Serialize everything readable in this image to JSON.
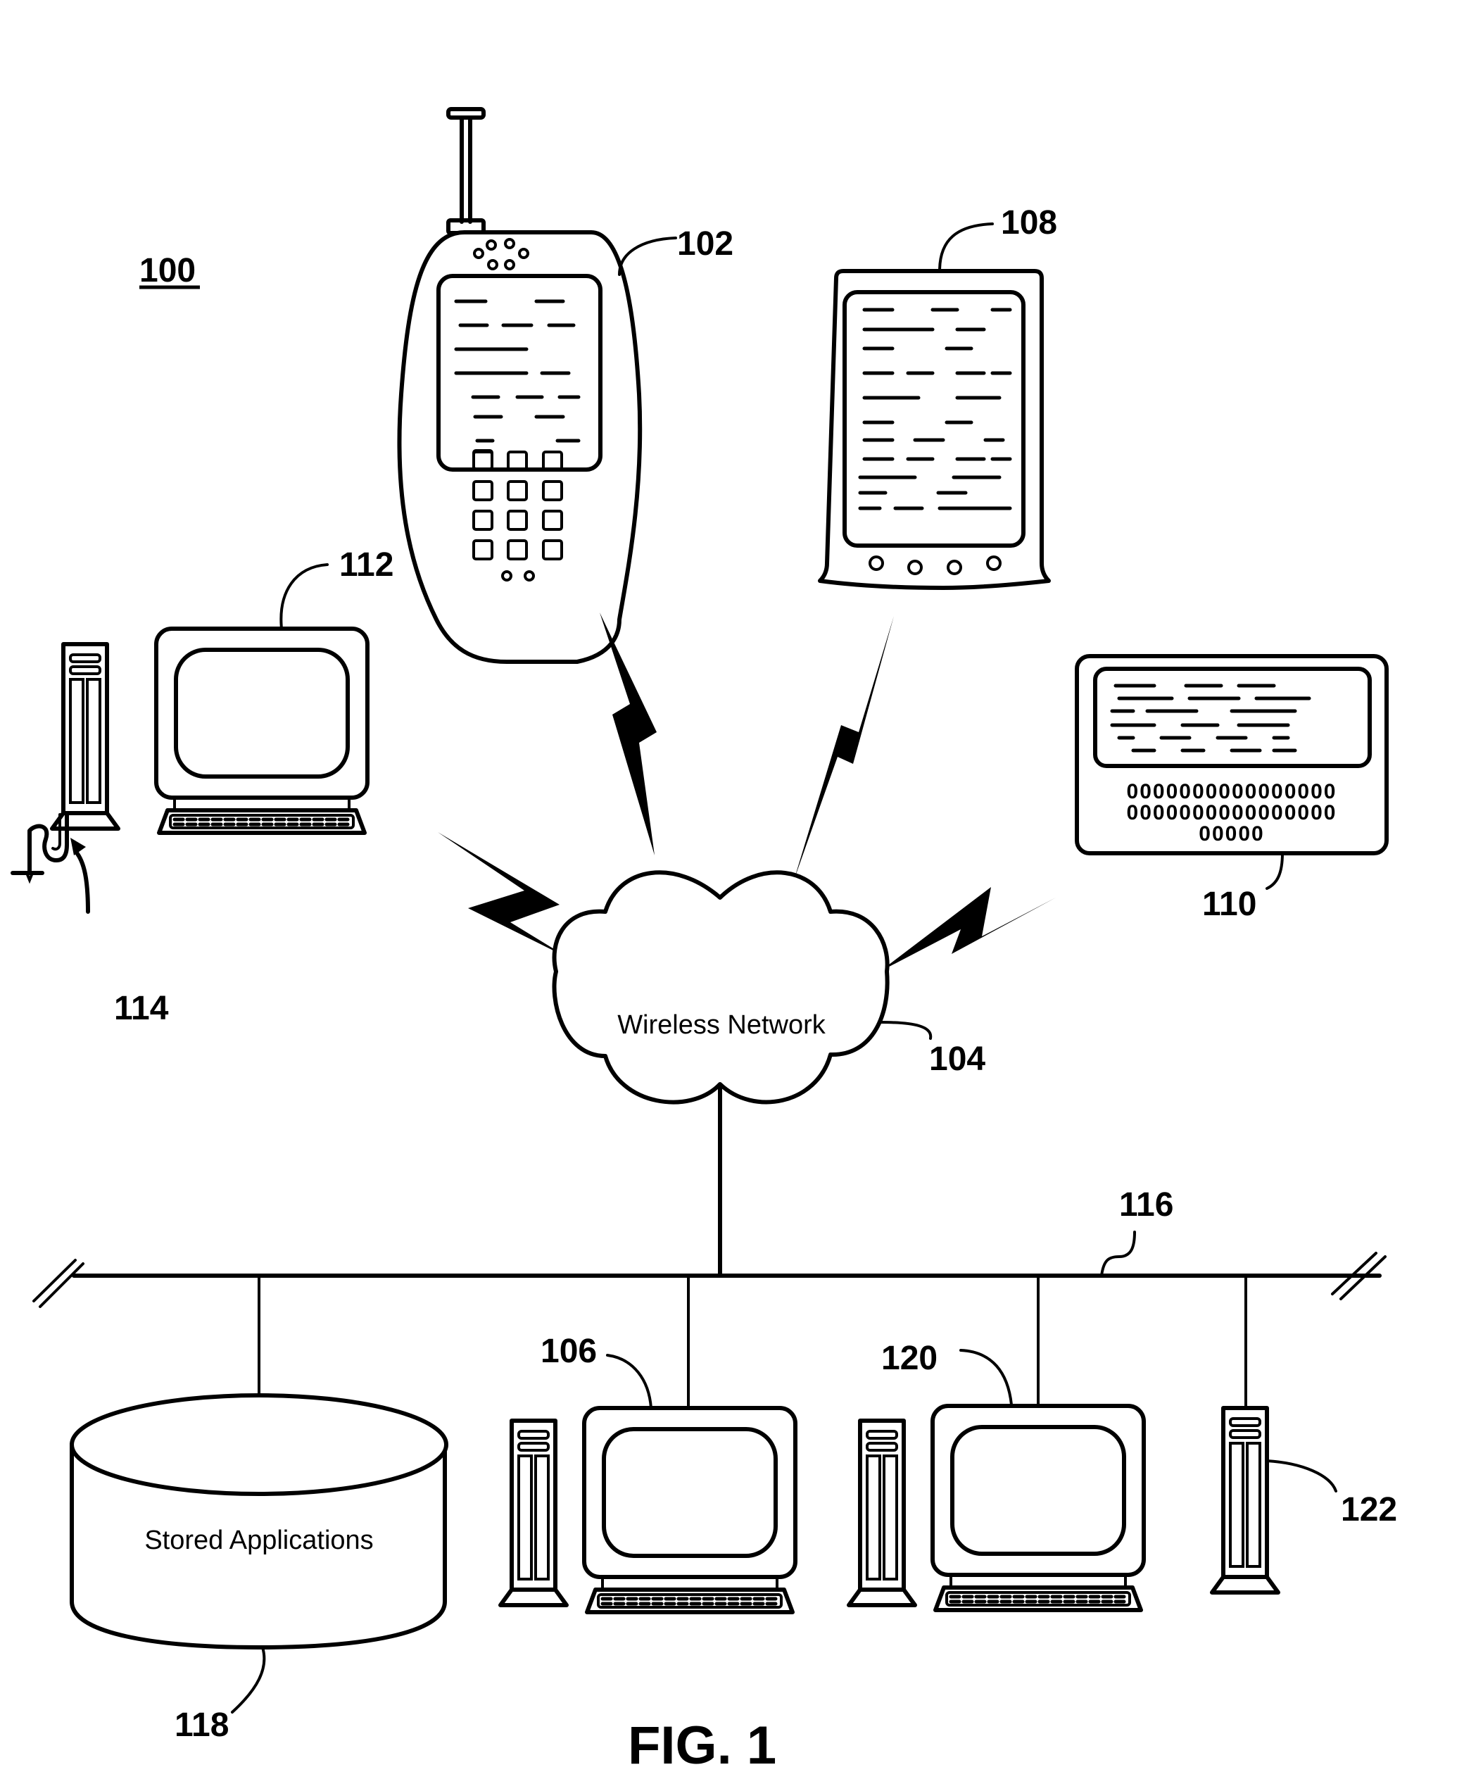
{
  "figure": {
    "caption": "FIG. 1",
    "system_ref": "100"
  },
  "nodes": {
    "mobile_phone": {
      "ref": "102",
      "type": "cellular-phone"
    },
    "wireless_network": {
      "ref": "104",
      "label": "Wireless Network"
    },
    "desktop_computer": {
      "ref": "106",
      "type": "desktop-computer"
    },
    "pda": {
      "ref": "108",
      "type": "pda"
    },
    "pager": {
      "ref": "110",
      "type": "two-way-pager",
      "keys_row1": "0000000000000000",
      "keys_row2": "0000000000000000",
      "keys_row3": "00000"
    },
    "wireless_computer": {
      "ref": "112",
      "type": "desktop-computer"
    },
    "ground_connection": {
      "ref": "114",
      "type": "ground-wire"
    },
    "network_bus": {
      "ref": "116",
      "type": "network-bus"
    },
    "database": {
      "ref": "118",
      "label": "Stored Applications"
    },
    "workstation": {
      "ref": "120",
      "type": "desktop-computer"
    },
    "server": {
      "ref": "122",
      "type": "tower-server"
    }
  },
  "edges": [
    {
      "from": "102",
      "to": "104",
      "kind": "wireless"
    },
    {
      "from": "108",
      "to": "104",
      "kind": "wireless"
    },
    {
      "from": "110",
      "to": "104",
      "kind": "wireless"
    },
    {
      "from": "112",
      "to": "104",
      "kind": "wireless"
    },
    {
      "from": "104",
      "to": "116",
      "kind": "wired"
    },
    {
      "from": "116",
      "to": "118",
      "kind": "wired"
    },
    {
      "from": "116",
      "to": "106",
      "kind": "wired"
    },
    {
      "from": "116",
      "to": "120",
      "kind": "wired"
    },
    {
      "from": "116",
      "to": "122",
      "kind": "wired"
    }
  ]
}
